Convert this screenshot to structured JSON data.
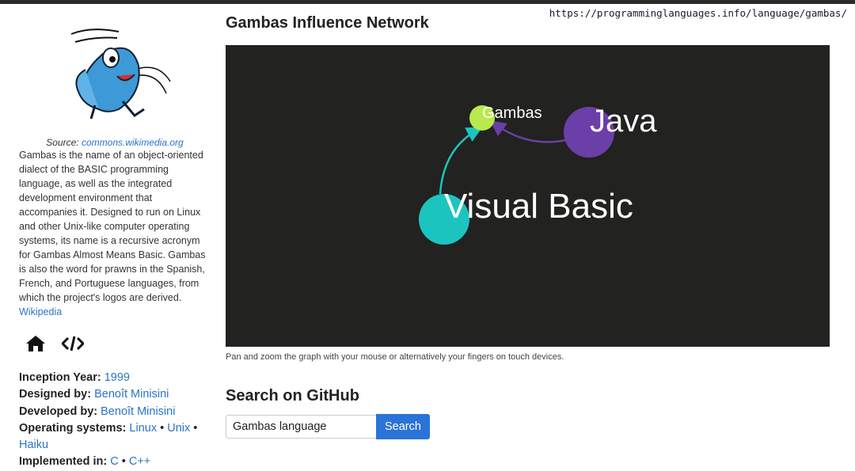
{
  "page": {
    "url": "https://programminglanguages.info/language/gambas/"
  },
  "sidebar": {
    "source_label": "Source:",
    "source_link": "commons.wikimedia.org",
    "description": "Gambas is the name of an object-oriented dialect of the BASIC programming language, as well as the integrated development environment that accompanies it. Designed to run on Linux and other Unix-like computer operating systems, its name is a recursive acronym for Gambas Almost Means Basic. Gambas is also the word for prawns in the Spanish, French, and Portuguese languages, from which the project's logos are derived.",
    "wikipedia_link": "Wikipedia",
    "icons": [
      "home-icon",
      "code-icon"
    ],
    "facts": {
      "inception_label": "Inception Year:",
      "inception_value": "1999",
      "designed_label": "Designed by:",
      "designed_value": "Benoît Minisini",
      "developed_label": "Developed by:",
      "developed_value": "Benoît Minisini",
      "os_label": "Operating systems:",
      "os_values": [
        "Linux",
        "Unix",
        "Haiku"
      ],
      "separator": "•",
      "implemented_label": "Implemented in:",
      "implemented_values": [
        "C",
        "C++"
      ]
    }
  },
  "main": {
    "title": "Gambas Influence Network",
    "graph": {
      "background": "#222220",
      "nodes": [
        {
          "label": "Gambas",
          "color": "#b8ea4d"
        },
        {
          "label": "Java",
          "color": "#6a3fa8"
        },
        {
          "label": "Visual Basic",
          "color": "#1cc4bf"
        }
      ],
      "edges": [
        {
          "from": "Visual Basic",
          "to": "Gambas",
          "color": "#1cc4bf"
        },
        {
          "from": "Java",
          "to": "Gambas",
          "color": "#6a3fa8"
        }
      ]
    },
    "caption": "Pan and zoom the graph with your mouse or alternatively your fingers on touch devices.",
    "search_heading": "Search on GitHub",
    "search_value": "Gambas language",
    "search_button": "Search"
  }
}
